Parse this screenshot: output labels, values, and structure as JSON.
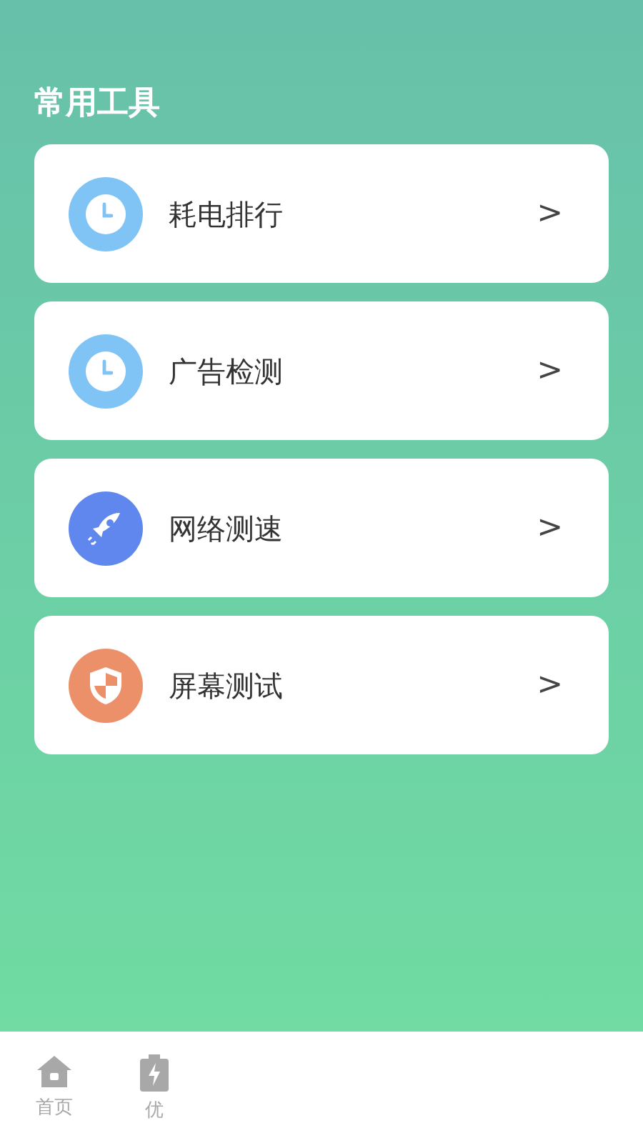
{
  "section_title": "常用工具",
  "tools": [
    {
      "kind": "clock",
      "label": "耗电排行",
      "chevron": ">"
    },
    {
      "kind": "clock",
      "label": "广告检测",
      "chevron": ">"
    },
    {
      "kind": "rocket",
      "label": "网络测速",
      "chevron": ">"
    },
    {
      "kind": "shield",
      "label": "屏幕测试",
      "chevron": ">"
    }
  ],
  "bottom_nav": [
    {
      "kind": "home",
      "label": "首页",
      "selected": false
    },
    {
      "kind": "battery",
      "label": "优",
      "selected": false
    }
  ]
}
